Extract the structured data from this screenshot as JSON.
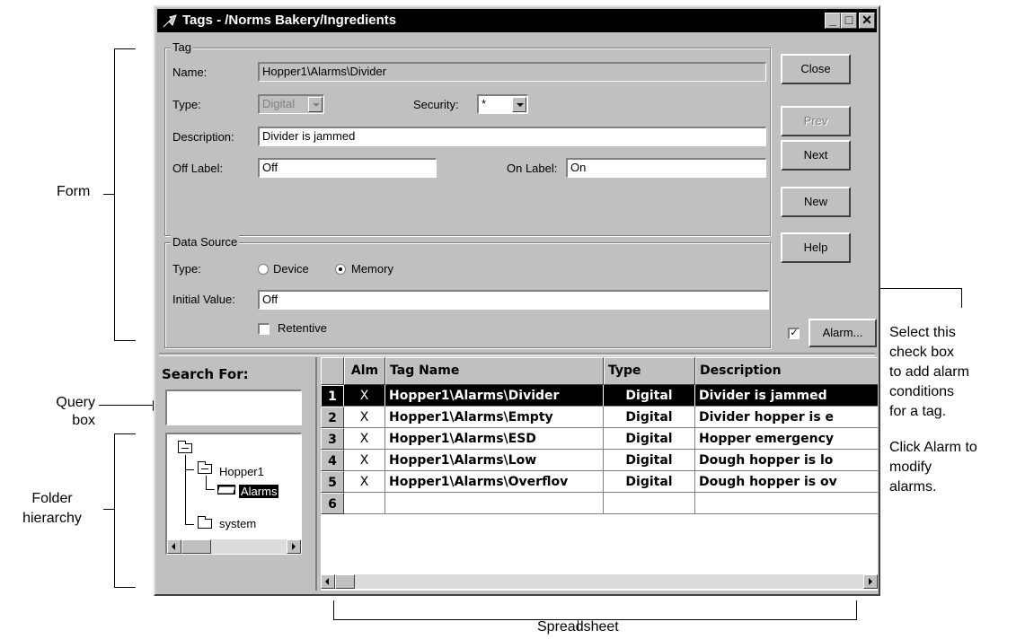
{
  "annotations": {
    "form": "Form",
    "query_box": [
      "Query",
      "box"
    ],
    "folder_hierarchy": [
      "Folder",
      "hierarchy"
    ],
    "spreadsheet": "Spreadsheet",
    "alarm_note": [
      "Select this",
      "check box",
      "to add alarm",
      "conditions",
      "for a tag.",
      "",
      "Click Alarm to",
      "modify",
      "alarms."
    ]
  },
  "window": {
    "title": "Tags - /Norms Bakery/Ingredients",
    "controls": [
      "_",
      "□",
      "✕"
    ]
  },
  "tag_group": {
    "title": "Tag",
    "name_label": "Name:",
    "name_value": "Hopper1\\Alarms\\Divider",
    "type_label": "Type:",
    "type_value": "Digital",
    "security_label": "Security:",
    "security_value": "*",
    "description_label": "Description:",
    "description_value": "Divider is jammed",
    "off_label_label": "Off Label:",
    "off_label_value": "Off",
    "on_label_label": "On Label:",
    "on_label_value": "On"
  },
  "data_source": {
    "title": "Data Source",
    "type_label": "Type:",
    "device_label": "Device",
    "memory_label": "Memory",
    "selected": "Memory",
    "initial_value_label": "Initial Value:",
    "initial_value": "Off",
    "retentive_label": "Retentive",
    "retentive_checked": false
  },
  "buttons": {
    "close": "Close",
    "prev": "Prev",
    "next": "Next",
    "new": "New",
    "help": "Help",
    "alarm": "Alarm...",
    "alarm_checked": true
  },
  "search": {
    "label": "Search For:",
    "value": ""
  },
  "tree": {
    "root": "",
    "hopper": "Hopper1",
    "alarms": "Alarms",
    "system": "system"
  },
  "table": {
    "headers": [
      "",
      "Alm",
      "Tag Name",
      "Type",
      "Description"
    ],
    "rows": [
      {
        "num": "1",
        "alm": "X",
        "name": "Hopper1\\Alarms\\Divider",
        "type": "Digital",
        "desc": "Divider is jammed"
      },
      {
        "num": "2",
        "alm": "X",
        "name": "Hopper1\\Alarms\\Empty",
        "type": "Digital",
        "desc": "Divider hopper is e"
      },
      {
        "num": "3",
        "alm": "X",
        "name": "Hopper1\\Alarms\\ESD",
        "type": "Digital",
        "desc": "Hopper emergency"
      },
      {
        "num": "4",
        "alm": "X",
        "name": "Hopper1\\Alarms\\Low",
        "type": "Digital",
        "desc": "Dough hopper is lo"
      },
      {
        "num": "5",
        "alm": "X",
        "name": "Hopper1\\Alarms\\Overflov",
        "type": "Digital",
        "desc": "Dough hopper is ov"
      },
      {
        "num": "6",
        "alm": "",
        "name": "",
        "type": "",
        "desc": ""
      }
    ],
    "selected_row": "1"
  }
}
